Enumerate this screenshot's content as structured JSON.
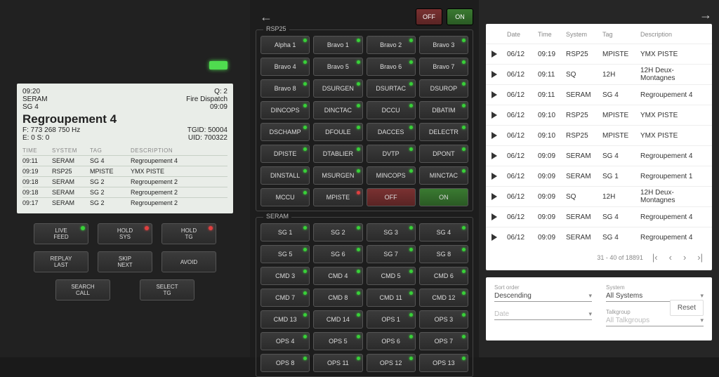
{
  "lcd": {
    "clock": "09:20",
    "queue": "Q: 2",
    "sys": "SERAM",
    "dispatch": "Fire Dispatch",
    "tag": "SG 4",
    "clock2": "09:09",
    "title": "Regroupement 4",
    "freq": "F: 773 268 750 Hz",
    "tgid": "TGID: 50004",
    "es": "E: 0 S: 0",
    "uid": "UID: 700322",
    "cols": {
      "time": "TIME",
      "sys": "SYSTEM",
      "tag": "TAG",
      "desc": "DESCRIPTION"
    },
    "rows": [
      {
        "time": "09:11",
        "sys": "SERAM",
        "tag": "SG 4",
        "desc": "Regroupement 4"
      },
      {
        "time": "09:19",
        "sys": "RSP25",
        "tag": "MPISTE",
        "desc": "YMX PISTE"
      },
      {
        "time": "09:18",
        "sys": "SERAM",
        "tag": "SG 2",
        "desc": "Regroupement 2"
      },
      {
        "time": "09:18",
        "sys": "SERAM",
        "tag": "SG 2",
        "desc": "Regroupement 2"
      },
      {
        "time": "09:17",
        "sys": "SERAM",
        "tag": "SG 2",
        "desc": "Regroupement 2"
      }
    ]
  },
  "controls": {
    "live": "LIVE\nFEED",
    "hsys": "HOLD\nSYS",
    "htg": "HOLD\nTG",
    "replay": "REPLAY\nLAST",
    "skip": "SKIP\nNEXT",
    "avoid": "AVOID",
    "search": "SEARCH\nCALL",
    "select": "SELECT\nTG"
  },
  "toggle": {
    "off": "OFF",
    "on": "ON"
  },
  "groups": [
    {
      "name": "RSP25",
      "items": [
        {
          "l": "Alpha 1",
          "d": "g"
        },
        {
          "l": "Bravo 1",
          "d": "g"
        },
        {
          "l": "Bravo 2",
          "d": "g"
        },
        {
          "l": "Bravo 3",
          "d": "g"
        },
        {
          "l": "Bravo 4",
          "d": "g"
        },
        {
          "l": "Bravo 5",
          "d": "g"
        },
        {
          "l": "Bravo 6",
          "d": "g"
        },
        {
          "l": "Bravo 7",
          "d": "g"
        },
        {
          "l": "Bravo 8",
          "d": "g"
        },
        {
          "l": "DSURGEN",
          "d": "g"
        },
        {
          "l": "DSURTAC",
          "d": "g"
        },
        {
          "l": "DSUROP",
          "d": "g"
        },
        {
          "l": "DINCOPS",
          "d": "g"
        },
        {
          "l": "DINCTAC",
          "d": "g"
        },
        {
          "l": "DCCU",
          "d": "g"
        },
        {
          "l": "DBATIM",
          "d": "g"
        },
        {
          "l": "DSCHAMP",
          "d": "g"
        },
        {
          "l": "DFOULE",
          "d": "g"
        },
        {
          "l": "DACCES",
          "d": "g"
        },
        {
          "l": "DELECTR",
          "d": "g"
        },
        {
          "l": "DPISTE",
          "d": "g"
        },
        {
          "l": "DTABLIER",
          "d": "g"
        },
        {
          "l": "DVTP",
          "d": "g"
        },
        {
          "l": "DPONT",
          "d": "g"
        },
        {
          "l": "DINSTALL",
          "d": "g"
        },
        {
          "l": "MSURGEN",
          "d": "g"
        },
        {
          "l": "MINCOPS",
          "d": "g"
        },
        {
          "l": "MINCTAC",
          "d": "g"
        },
        {
          "l": "MCCU",
          "d": "g"
        },
        {
          "l": "MPISTE",
          "d": "r"
        },
        {
          "l": "OFF",
          "t": "off"
        },
        {
          "l": "ON",
          "t": "on"
        }
      ]
    },
    {
      "name": "SERAM",
      "items": [
        {
          "l": "SG 1",
          "d": "g"
        },
        {
          "l": "SG 2",
          "d": "g"
        },
        {
          "l": "SG 3",
          "d": "g"
        },
        {
          "l": "SG 4",
          "d": "g"
        },
        {
          "l": "SG 5",
          "d": "g"
        },
        {
          "l": "SG 6",
          "d": "g"
        },
        {
          "l": "SG 7",
          "d": "g"
        },
        {
          "l": "SG 8",
          "d": "g"
        },
        {
          "l": "CMD 3",
          "d": "g"
        },
        {
          "l": "CMD 4",
          "d": "g"
        },
        {
          "l": "CMD 5",
          "d": "g"
        },
        {
          "l": "CMD 6",
          "d": "g"
        },
        {
          "l": "CMD 7",
          "d": "g"
        },
        {
          "l": "CMD 8",
          "d": "g"
        },
        {
          "l": "CMD 11",
          "d": "g"
        },
        {
          "l": "CMD 12",
          "d": "g"
        },
        {
          "l": "CMD 13",
          "d": "g"
        },
        {
          "l": "CMD 14",
          "d": "g"
        },
        {
          "l": "OPS 1",
          "d": "g"
        },
        {
          "l": "OPS 3",
          "d": "g"
        },
        {
          "l": "OPS 4",
          "d": "g"
        },
        {
          "l": "OPS 5",
          "d": "g"
        },
        {
          "l": "OPS 6",
          "d": "g"
        },
        {
          "l": "OPS 7",
          "d": "g"
        },
        {
          "l": "OPS 8",
          "d": "g"
        },
        {
          "l": "OPS 11",
          "d": "g"
        },
        {
          "l": "OPS 12",
          "d": "g"
        },
        {
          "l": "OPS 13",
          "d": "g"
        }
      ]
    }
  ],
  "calls": {
    "cols": {
      "date": "Date",
      "time": "Time",
      "sys": "System",
      "tag": "Tag",
      "desc": "Description"
    },
    "rows": [
      {
        "date": "06/12",
        "time": "09:19",
        "sys": "RSP25",
        "tag": "MPISTE",
        "desc": "YMX PISTE"
      },
      {
        "date": "06/12",
        "time": "09:11",
        "sys": "SQ",
        "tag": "12H",
        "desc": "12H Deux-Montagnes"
      },
      {
        "date": "06/12",
        "time": "09:11",
        "sys": "SERAM",
        "tag": "SG 4",
        "desc": "Regroupement 4"
      },
      {
        "date": "06/12",
        "time": "09:10",
        "sys": "RSP25",
        "tag": "MPISTE",
        "desc": "YMX PISTE"
      },
      {
        "date": "06/12",
        "time": "09:10",
        "sys": "RSP25",
        "tag": "MPISTE",
        "desc": "YMX PISTE"
      },
      {
        "date": "06/12",
        "time": "09:09",
        "sys": "SERAM",
        "tag": "SG 4",
        "desc": "Regroupement 4"
      },
      {
        "date": "06/12",
        "time": "09:09",
        "sys": "SERAM",
        "tag": "SG 1",
        "desc": "Regroupement 1"
      },
      {
        "date": "06/12",
        "time": "09:09",
        "sys": "SQ",
        "tag": "12H",
        "desc": "12H Deux-Montagnes"
      },
      {
        "date": "06/12",
        "time": "09:09",
        "sys": "SERAM",
        "tag": "SG 4",
        "desc": "Regroupement 4"
      },
      {
        "date": "06/12",
        "time": "09:09",
        "sys": "SERAM",
        "tag": "SG 4",
        "desc": "Regroupement 4"
      }
    ],
    "pager": "31 - 40 of 18891"
  },
  "filter": {
    "sort_label": "Sort order",
    "sort_val": "Descending",
    "sys_label": "System",
    "sys_val": "All Systems",
    "date_label": "Date",
    "date_val": "",
    "tg_label": "Talkgroup",
    "tg_val": "All Talkgroups",
    "reset": "Reset",
    "date_placeholder": "Date"
  }
}
